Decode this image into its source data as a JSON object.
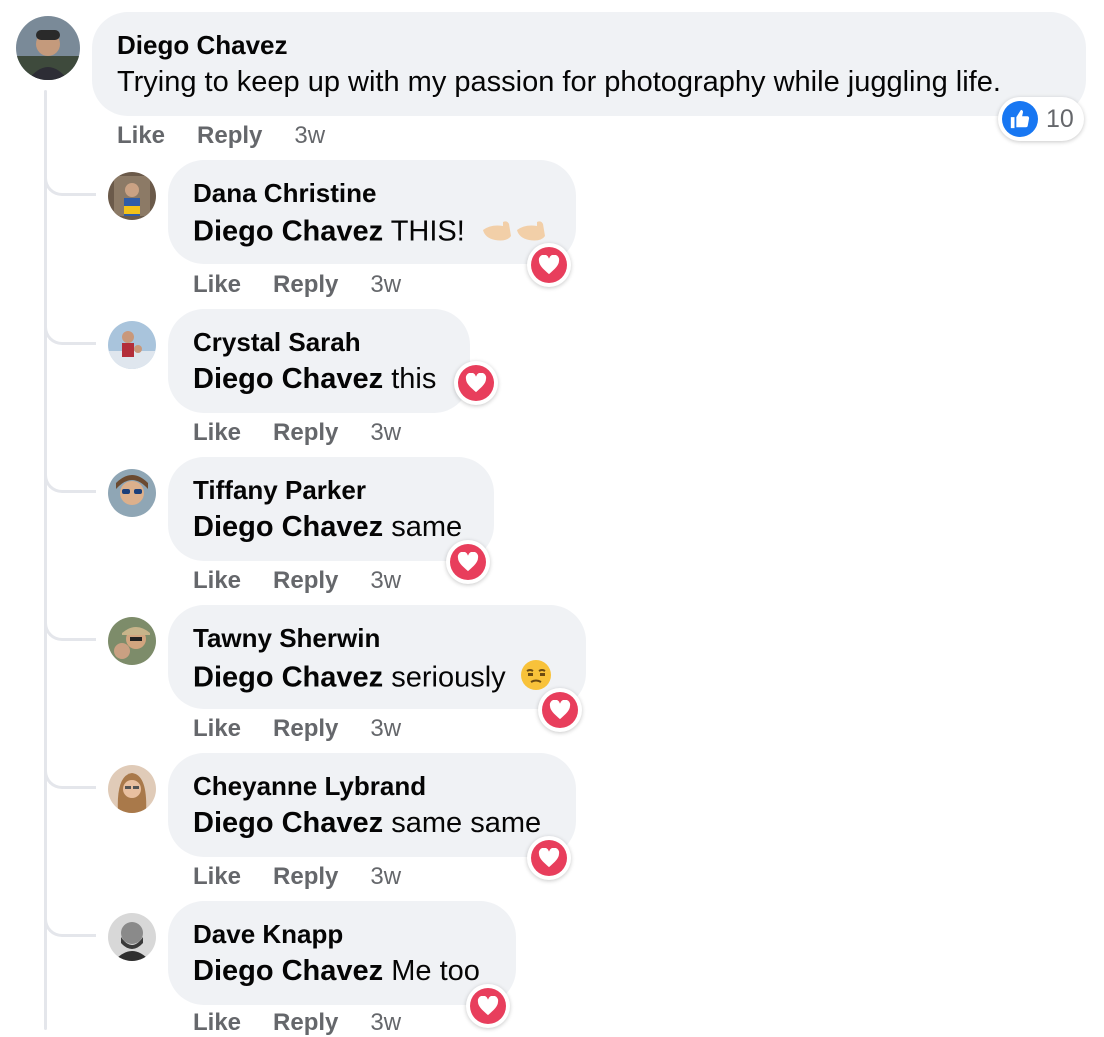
{
  "main_comment": {
    "author": "Diego Chavez",
    "text": "Trying to keep up with my passion for photography while juggling life.",
    "like_label": "Like",
    "reply_label": "Reply",
    "time": "3w",
    "reaction": {
      "type": "like",
      "icon": "thumbs-up-icon",
      "count": "10",
      "color": "#1877f2"
    }
  },
  "replies": [
    {
      "author": "Dana Christine",
      "mention": "Diego Chavez",
      "text": " THIS!",
      "emoji": "pointing-left-hands-emoji",
      "like_label": "Like",
      "reply_label": "Reply",
      "time": "3w",
      "reaction": "heart-icon"
    },
    {
      "author": "Crystal Sarah",
      "mention": "Diego Chavez",
      "text": " this",
      "like_label": "Like",
      "reply_label": "Reply",
      "time": "3w",
      "reaction": "heart-icon"
    },
    {
      "author": "Tiffany Parker",
      "mention": "Diego Chavez",
      "text": " same",
      "like_label": "Like",
      "reply_label": "Reply",
      "time": "3w",
      "reaction": "heart-icon"
    },
    {
      "author": "Tawny Sherwin",
      "mention": "Diego Chavez",
      "text": " seriously",
      "emoji": "unamused-face-emoji",
      "like_label": "Like",
      "reply_label": "Reply",
      "time": "3w",
      "reaction": "heart-icon"
    },
    {
      "author": "Cheyanne Lybrand",
      "mention": "Diego Chavez",
      "text": " same same",
      "like_label": "Like",
      "reply_label": "Reply",
      "time": "3w",
      "reaction": "heart-icon"
    },
    {
      "author": "Dave Knapp",
      "mention": "Diego Chavez",
      "text": " Me too",
      "like_label": "Like",
      "reply_label": "Reply",
      "time": "3w",
      "reaction": "heart-icon"
    }
  ],
  "colors": {
    "bubble": "#f0f2f5",
    "heart": "#e83e5c",
    "like": "#1877f2",
    "meta": "#65676b"
  }
}
